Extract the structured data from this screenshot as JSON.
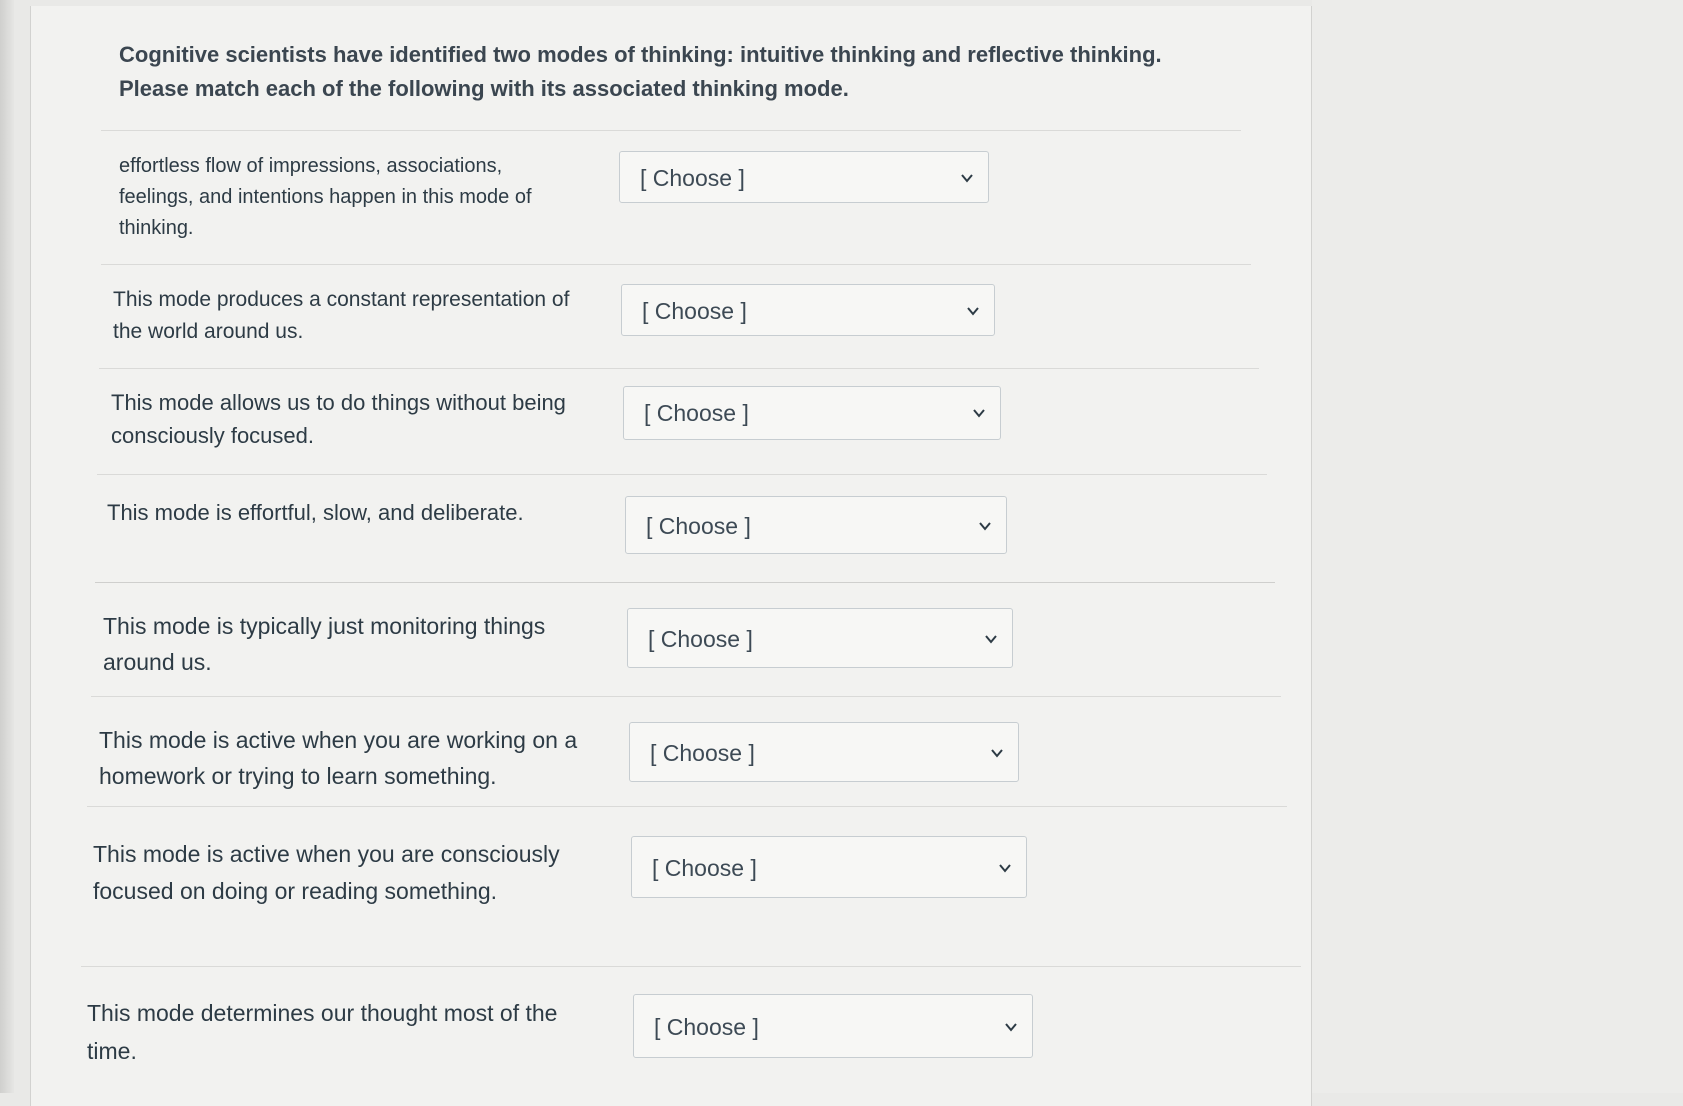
{
  "question": {
    "text": "Cognitive scientists have identified two modes of thinking: intuitive thinking and reflective thinking. Please match each of the following with its associated thinking mode."
  },
  "matches": [
    {
      "prompt": "effortless flow of impressions, associations, feelings, and intentions happen in this mode of thinking.",
      "selected": "[ Choose ]"
    },
    {
      "prompt": "This mode produces a constant representation of the world around us.",
      "selected": "[ Choose ]"
    },
    {
      "prompt": "This mode allows us to do things without being consciously focused.",
      "selected": "[ Choose ]"
    },
    {
      "prompt": "This mode is effortful, slow, and deliberate.",
      "selected": "[ Choose ]"
    },
    {
      "prompt": "This mode is typically just monitoring things around us.",
      "selected": "[ Choose ]"
    },
    {
      "prompt": "This mode is active when you are working on a homework or trying to learn something.",
      "selected": "[ Choose ]"
    },
    {
      "prompt": "This mode is active when you are consciously focused on doing or reading something.",
      "selected": "[ Choose ]"
    },
    {
      "prompt": "This mode determines our thought most of the time.",
      "selected": "[ Choose ]"
    }
  ],
  "icons": {
    "dropdown": "chevron-down-icon"
  }
}
